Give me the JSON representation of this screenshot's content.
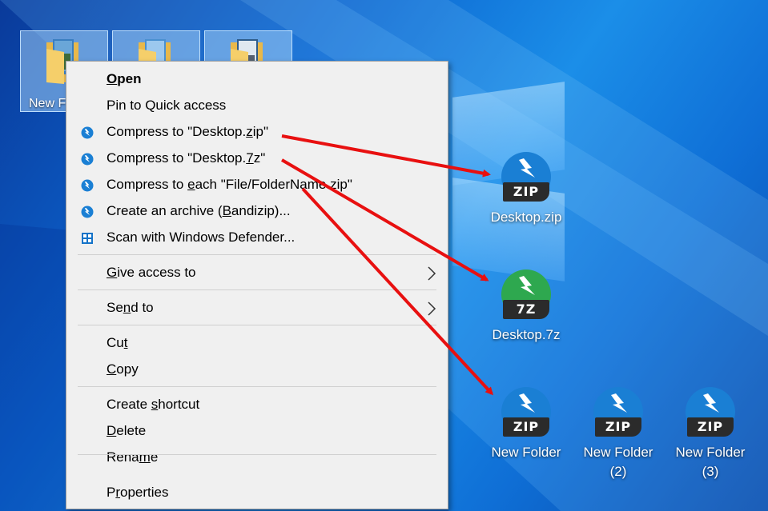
{
  "selected_folders": {
    "first_label": "New F"
  },
  "context_menu": {
    "items": [
      {
        "id": "open",
        "pre": "",
        "acc": "O",
        "post": "pen",
        "bold": true,
        "icon": ""
      },
      {
        "id": "pin",
        "pre": "Pin to Quick access",
        "acc": "",
        "post": "",
        "bold": false,
        "icon": ""
      },
      {
        "id": "compress-zip",
        "pre": "Compress to \"Desktop.",
        "acc": "z",
        "post": "ip\"",
        "bold": false,
        "icon": "bandizip-icon"
      },
      {
        "id": "compress-7z",
        "pre": "Compress to \"Desktop.",
        "acc": "7",
        "post": "z\"",
        "bold": false,
        "icon": "bandizip-icon"
      },
      {
        "id": "compress-each",
        "pre": "Compress to ",
        "acc": "e",
        "post": "ach \"File/FolderName.zip\"",
        "bold": false,
        "icon": "bandizip-icon"
      },
      {
        "id": "create-archive",
        "pre": "Create an archive (",
        "acc": "B",
        "post": "andizip)...",
        "bold": false,
        "icon": "bandizip-icon"
      },
      {
        "id": "scan-defender",
        "pre": "Scan with Windows Defender...",
        "acc": "",
        "post": "",
        "bold": false,
        "icon": "windows-defender-icon"
      },
      {
        "id": "give-access",
        "pre": "",
        "acc": "G",
        "post": "ive access to",
        "bold": false,
        "icon": "",
        "submenu": true
      },
      {
        "id": "send-to",
        "pre": "Se",
        "acc": "n",
        "post": "d to",
        "bold": false,
        "icon": "",
        "submenu": true
      },
      {
        "id": "cut",
        "pre": "Cu",
        "acc": "t",
        "post": "",
        "bold": false,
        "icon": ""
      },
      {
        "id": "copy",
        "pre": "",
        "acc": "C",
        "post": "opy",
        "bold": false,
        "icon": ""
      },
      {
        "id": "create-shortcut",
        "pre": "Create ",
        "acc": "s",
        "post": "hortcut",
        "bold": false,
        "icon": ""
      },
      {
        "id": "delete",
        "pre": "",
        "acc": "D",
        "post": "elete",
        "bold": false,
        "icon": ""
      },
      {
        "id": "rename",
        "pre": "Rena",
        "acc": "m",
        "post": "e",
        "bold": false,
        "icon": ""
      },
      {
        "id": "properties",
        "pre": "P",
        "acc": "r",
        "post": "operties",
        "bold": false,
        "icon": ""
      }
    ]
  },
  "desktop_icons": {
    "zip": {
      "tag": "ZIP",
      "label": "Desktop.zip",
      "color": "#1a7fd4"
    },
    "sevenz": {
      "tag": "7Z",
      "label": "Desktop.7z",
      "color": "#2ea84f"
    },
    "folder1": {
      "tag": "ZIP",
      "label": "New Folder",
      "color": "#1a7fd4"
    },
    "folder2": {
      "tag": "ZIP",
      "label": "New Folder (2)",
      "color": "#1a7fd4"
    },
    "folder3": {
      "tag": "ZIP",
      "label": "New Folder (3)",
      "color": "#1a7fd4"
    }
  },
  "colors": {
    "arrow": "#e81010",
    "menu_bg": "#f0f0f0"
  }
}
